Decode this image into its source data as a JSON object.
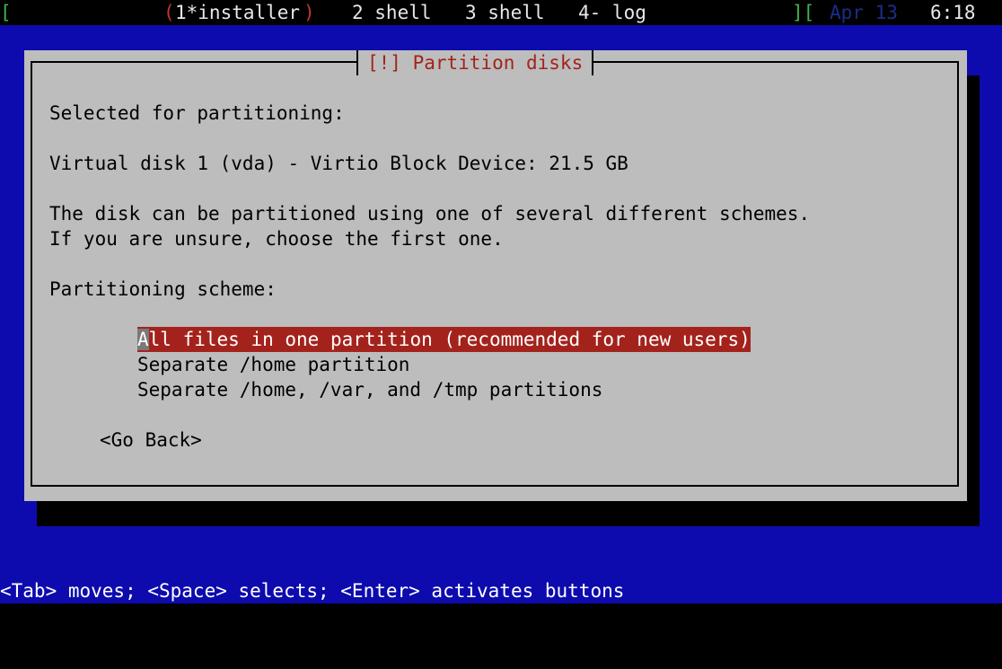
{
  "statusbar": {
    "left_bracket": "[",
    "win1_open": "(",
    "win1_label": "1*installer",
    "win1_close": ")",
    "win2_label": "2 shell",
    "win3_label": "3 shell",
    "win4_label": "4- log",
    "right_bracket": "][",
    "date": "Apr 13",
    "time": "6:18"
  },
  "dialog": {
    "title": "[!] Partition disks",
    "selected_heading": "Selected for partitioning:",
    "disk_line": "Virtual disk 1 (vda) - Virtio Block Device: 21.5 GB",
    "description_line1": "The disk can be partitioned using one of several different schemes.",
    "description_line2": "If you are unsure, choose the first one.",
    "scheme_heading": "Partitioning scheme:",
    "options": [
      {
        "cursor_char": "A",
        "rest": "ll files in one partition (recommended for new users)"
      },
      {
        "label": "Separate /home partition"
      },
      {
        "label": "Separate /home, /var, and /tmp partitions"
      }
    ],
    "go_back": "<Go Back>"
  },
  "helpbar": {
    "text": "<Tab> moves; <Space> selects; <Enter> activates buttons"
  },
  "colors": {
    "background_blue": "#0d0bae",
    "dialog_gray": "#bdbdbd",
    "accent_red": "#a3231c",
    "status_green": "#3fb34f"
  }
}
